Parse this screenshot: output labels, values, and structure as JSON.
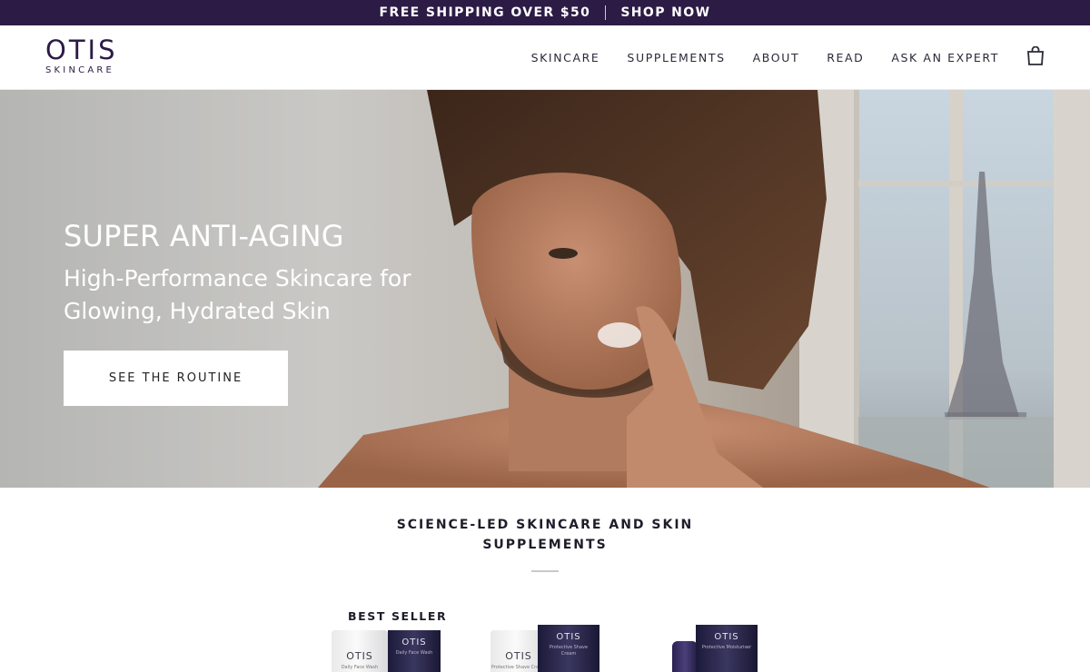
{
  "announcement": {
    "shipping_text": "FREE SHIPPING OVER $50",
    "cta_label": "SHOP NOW"
  },
  "header": {
    "logo_main": "OTIS",
    "logo_sub": "SKINCARE",
    "nav": [
      "SKINCARE",
      "SUPPLEMENTS",
      "ABOUT",
      "READ",
      "ASK AN EXPERT"
    ],
    "cart_icon": "shopping-bag-icon"
  },
  "hero": {
    "title": "SUPER ANTI-AGING",
    "subtitle": "High-Performance Skincare for Glowing, Hydrated Skin",
    "cta_label": "SEE THE ROUTINE"
  },
  "section": {
    "title": "SCIENCE-LED SKINCARE AND SKIN SUPPLEMENTS",
    "badge": "BEST SELLER"
  },
  "products": [
    {
      "tube_brand": "OTIS",
      "tube_text": "Daily Face Wash",
      "box_brand": "OTIS",
      "box_text": "Daily Face Wash"
    },
    {
      "tube_brand": "OTIS",
      "tube_text": "Protective Shave Cream",
      "box_brand": "OTIS",
      "box_text": "Protective Shave Cream"
    },
    {
      "box_brand": "OTIS",
      "box_text": "Protective Moisturiser"
    }
  ],
  "colors": {
    "brand": "#2c1b45",
    "hero_text": "#ffffff",
    "button_bg": "#ffffff"
  }
}
